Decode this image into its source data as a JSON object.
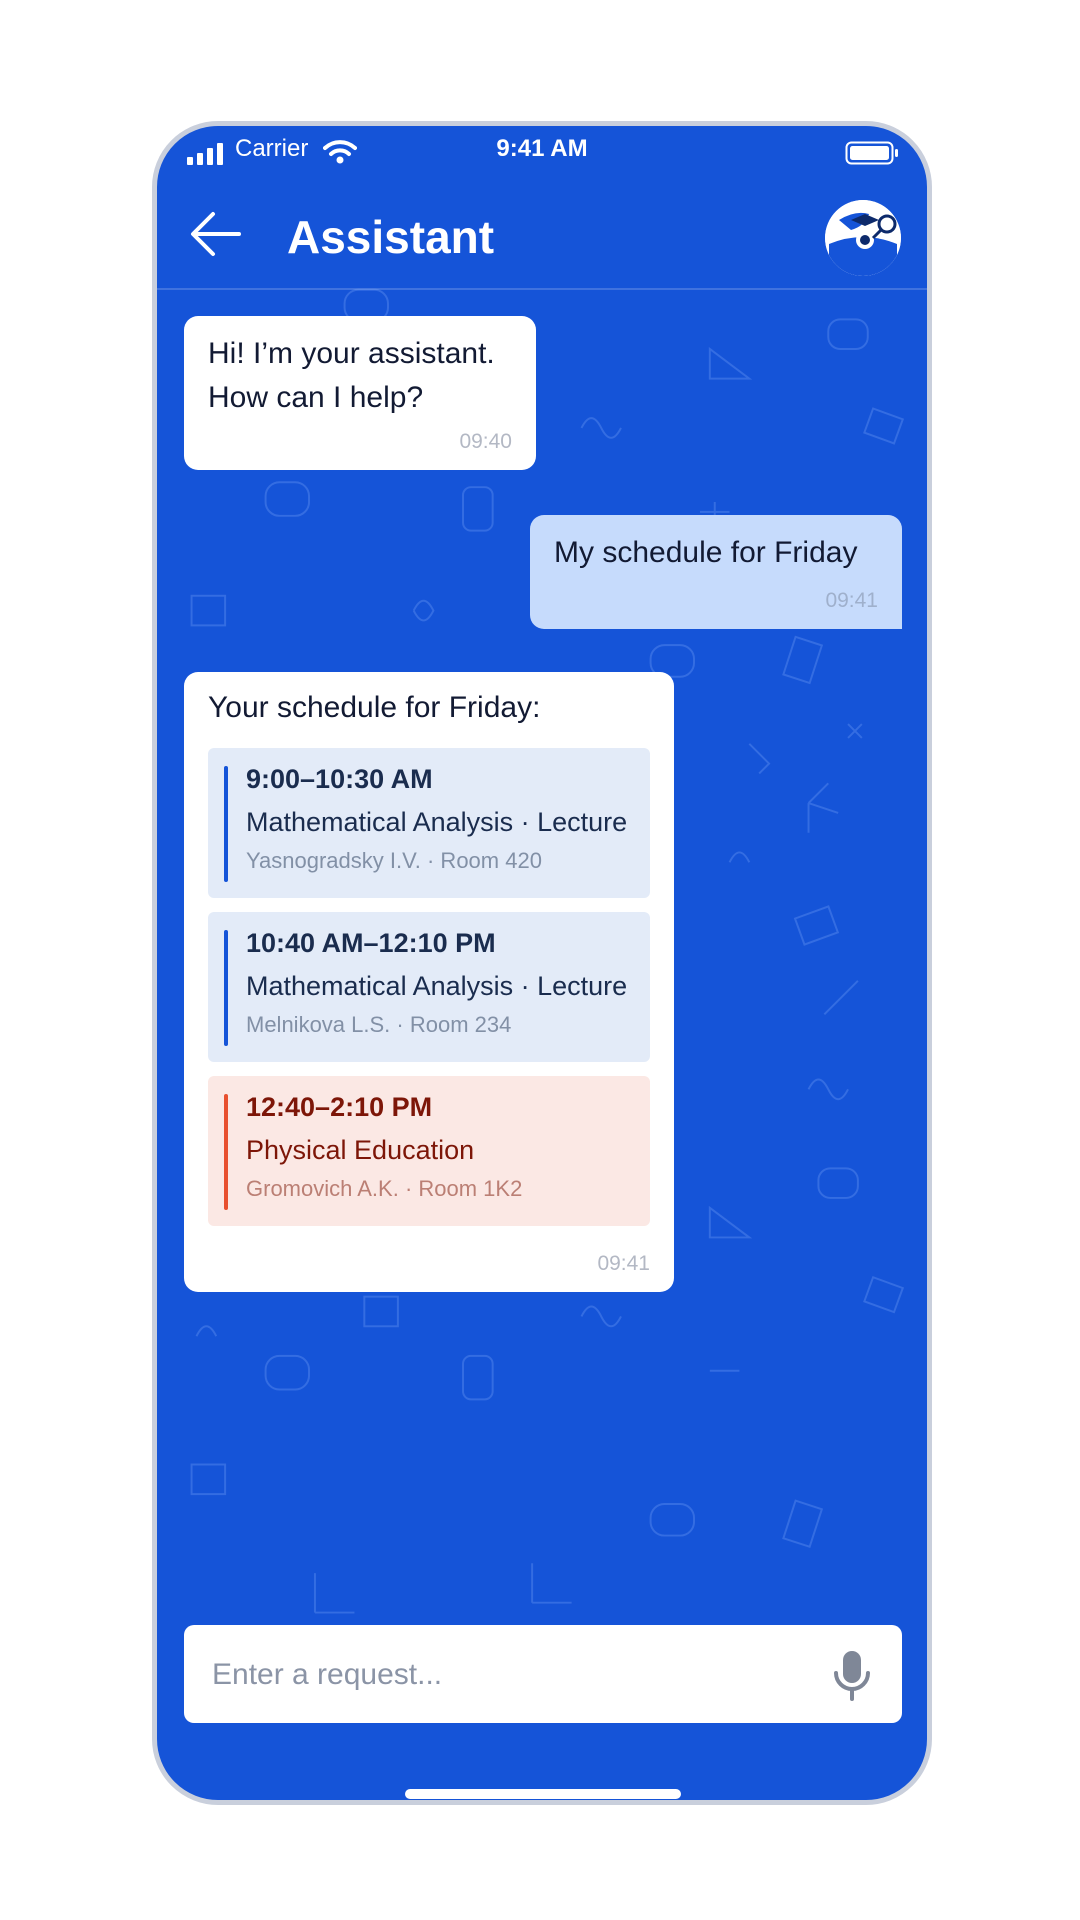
{
  "status_bar": {
    "carrier": "Carrier",
    "time": "9:41 AM"
  },
  "header": {
    "title": "Assistant"
  },
  "messages": [
    {
      "from": "assistant",
      "lines": [
        "Hi! I’m your assistant.",
        "How can I help?"
      ],
      "time": "09:40"
    },
    {
      "from": "user",
      "text": "My schedule for Friday",
      "time": "09:41"
    },
    {
      "from": "assistant",
      "intro": "Your schedule for Friday:",
      "time": "09:41",
      "classes": [
        {
          "time": "9:00–10:30 AM",
          "subject": "Mathematical Analysis · Lecture",
          "meta": "Yasnogradsky I.V. · Room 420",
          "accent": "#1554d8"
        },
        {
          "time": "10:40 AM–12:10 PM",
          "subject": "Mathematical Analysis · Lecture",
          "meta": "Melnikova L.S. · Room 234",
          "accent": "#1554d8"
        },
        {
          "time": "12:40–2:10 PM",
          "subject": "Physical Education",
          "meta": "Gromovich A.K. · Room 1K2",
          "accent": "#e8502f"
        }
      ]
    }
  ],
  "input": {
    "placeholder": "Enter a request..."
  },
  "icons": {
    "back": "arrow-left-icon",
    "avatar": "assistant-avatar-icon",
    "mic": "microphone-icon",
    "signal": "signal-icon",
    "wifi": "wifi-icon",
    "battery": "battery-icon"
  },
  "colors": {
    "background": "#1554d8",
    "user_bubble": "#c6dbfc",
    "accent_blue": "#1554d8",
    "accent_red": "#e8502f"
  }
}
